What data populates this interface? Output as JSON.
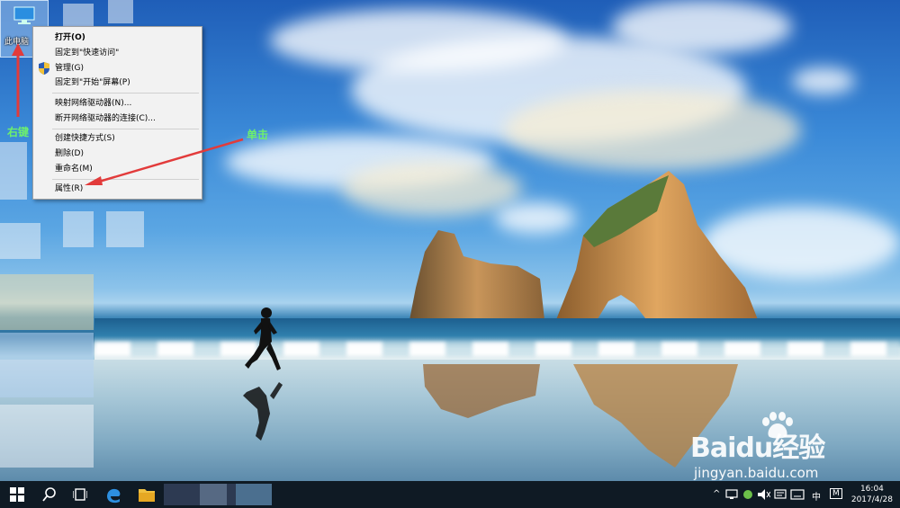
{
  "desktop": {
    "this_pc_label": "此电脑"
  },
  "context_menu": {
    "items": [
      {
        "label": "打开(O)"
      },
      {
        "label": "固定到\"快速访问\""
      },
      {
        "label": "管理(G)"
      },
      {
        "label": "固定到\"开始\"屏幕(P)"
      },
      {
        "label": "映射网络驱动器(N)..."
      },
      {
        "label": "断开网络驱动器的连接(C)..."
      },
      {
        "label": "创建快捷方式(S)"
      },
      {
        "label": "删除(D)"
      },
      {
        "label": "重命名(M)"
      },
      {
        "label": "属性(R)"
      }
    ]
  },
  "annotations": {
    "right_click": "右键",
    "single_click": "单击",
    "arrow_color": "#e23b3b",
    "text_color": "#6df06d"
  },
  "watermark": {
    "brand": "Baidu经验",
    "url": "jingyan.baidu.com"
  },
  "taskbar": {
    "icons": [
      "windows-start-icon",
      "search-icon",
      "task-view-icon",
      "edge-icon",
      "file-explorer-icon"
    ],
    "tray": {
      "ime": "中",
      "mode": "M"
    },
    "clock": {
      "time": "16:04",
      "date": "2017/4/28"
    }
  }
}
